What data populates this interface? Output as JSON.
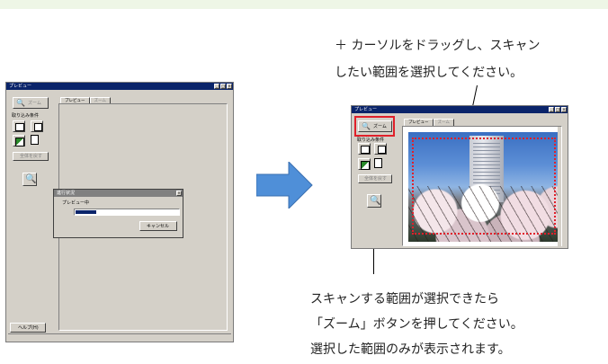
{
  "left_window": {
    "title": "プレビュー",
    "zoom_label": "ズーム",
    "group_label": "取り込み条件",
    "disabled_button": "全体を戻す",
    "tabs": [
      "プレビュー",
      "ズーム"
    ],
    "help_button": "ヘルプ(H)",
    "progress_dialog": {
      "title": "進行状況",
      "status": "プレビュー中",
      "progress": 0.2,
      "cancel_button": "キャンセル"
    }
  },
  "right_window": {
    "title": "プレビュー",
    "zoom_label": "ズーム",
    "group_label": "取り込み条件",
    "disabled_button": "全体を戻す",
    "tabs": [
      "プレビュー",
      "ズーム"
    ]
  },
  "captions": {
    "top_line1": "＋ カーソルをドラッグし、スキャン",
    "top_line2": "したい範囲を選択してください。",
    "bottom_line1": "スキャンする範囲が選択できたら",
    "bottom_line2": "「ズーム」ボタンを押してください。",
    "bottom_line3": "選択した範囲のみが表示されます。"
  },
  "colors": {
    "arrow": "#4f8fd8",
    "highlight_box": "#e0202a",
    "selection_marquee": "#e0202a",
    "title_bar": "#0a246a",
    "progress_fill": "#0a246a"
  }
}
